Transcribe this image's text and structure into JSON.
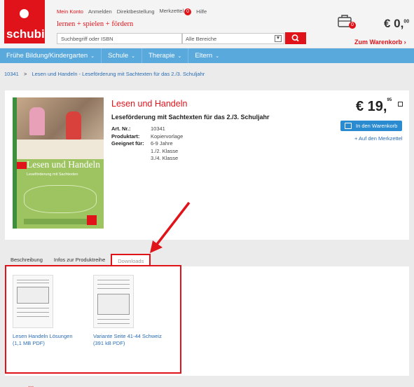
{
  "header": {
    "logo_text": "schubi",
    "top_links": [
      "Mein Konto",
      "Anmelden",
      "Direktbestellung",
      "Merkzettel",
      "Hilfe"
    ],
    "wishlist_count": "0",
    "slogan": "lernen + spielen + fördern",
    "search_placeholder": "Suchbegriff oder ISBN",
    "category_select": "Alle Bereiche",
    "cart_count": "0",
    "cart_price_main": "€ 0,",
    "cart_price_cents": "00",
    "cart_link": "Zum Warenkorb ›"
  },
  "nav": {
    "items": [
      "Frühe Bildung/Kindergarten",
      "Schule",
      "Therapie",
      "Eltern"
    ]
  },
  "breadcrumb": {
    "id": "10341",
    "separator": ">",
    "current": "Lesen und Handeln - Leseförderung mit Sachtexten für das 2./3. Schuljahr"
  },
  "product": {
    "cover_title": "Lesen und Handeln",
    "cover_subtitle": "Leseförderung mit Sachtexten",
    "title": "Lesen und Handeln",
    "subtitle": "Leseförderung mit Sachtexten für das 2./3. Schuljahr",
    "specs": [
      {
        "key": "Art. Nr.:",
        "value": "10341"
      },
      {
        "key": "Produktart:",
        "value": "Kopiervorlage"
      },
      {
        "key": "Geeignet für:",
        "value": "6-9 Jahre"
      },
      {
        "key": "",
        "value": "1./2. Klasse"
      },
      {
        "key": "",
        "value": "3./4. Klasse"
      }
    ],
    "price_main": "€ 19,",
    "price_cents": "95",
    "cart_button": "In den Warenkorb",
    "wishlist_link": "+ Auf den Merkzettel"
  },
  "tabs": [
    "Beschreibung",
    "Infos zur Produktreihe",
    "Downloads"
  ],
  "downloads": [
    {
      "title": "Lesen Handeln Lösungen",
      "size": "(1,1 MB PDF)"
    },
    {
      "title": "Variante Seite 41-44 Schweiz",
      "size": "(391 kB PDF)"
    }
  ],
  "footer_partial": "..."
}
